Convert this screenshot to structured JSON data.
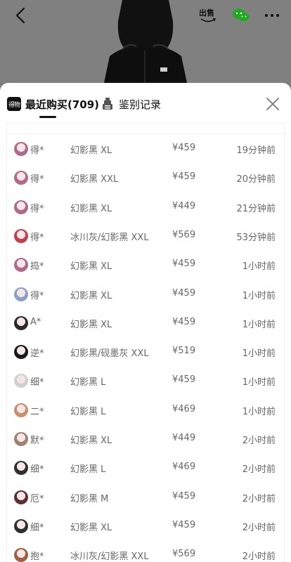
{
  "tabs": {
    "recent_label": "最近购买(709)",
    "auth_label": "鉴别记录",
    "logo_text": "得物"
  },
  "header": {
    "sell_label": "出售"
  },
  "purchases": [
    {
      "name": "得*",
      "spec": "幻影黑 XL",
      "price": "¥459",
      "time": "19分钟前",
      "avatar": "#b06a8a"
    },
    {
      "name": "得*",
      "spec": "幻影黑 XXL",
      "price": "¥459",
      "time": "20分钟前",
      "avatar": "#b06a8a"
    },
    {
      "name": "得*",
      "spec": "幻影黑 XL",
      "price": "¥449",
      "time": "21分钟前",
      "avatar": "#b06a8a"
    },
    {
      "name": "得*",
      "spec": "冰川灰/幻影黑 XXL",
      "price": "¥569",
      "time": "53分钟前",
      "avatar": "#c04050"
    },
    {
      "name": "捣*",
      "spec": "幻影黑 XL",
      "price": "¥459",
      "time": "1小时前",
      "avatar": "#b06a8a"
    },
    {
      "name": "得*",
      "spec": "幻影黑 XL",
      "price": "¥459",
      "time": "1小时前",
      "avatar": "#8ba0c8"
    },
    {
      "name": "A*",
      "spec": "幻影黑 XL",
      "price": "¥459",
      "time": "1小时前",
      "avatar": "#2a2a2a"
    },
    {
      "name": "逆*",
      "spec": "幻影黑/砚墨灰 XXL",
      "price": "¥519",
      "time": "1小时前",
      "avatar": "#1a1a1a"
    },
    {
      "name": "细*",
      "spec": "幻影黑 L",
      "price": "¥459",
      "time": "1小时前",
      "avatar": "#d0d0d0"
    },
    {
      "name": "二*",
      "spec": "幻影黑 L",
      "price": "¥469",
      "time": "1小时前",
      "avatar": "#c89070"
    },
    {
      "name": "默*",
      "spec": "幻影黑 XL",
      "price": "¥449",
      "time": "2小时前",
      "avatar": "#a08070"
    },
    {
      "name": "细*",
      "spec": "幻影黑 L",
      "price": "¥469",
      "time": "2小时前",
      "avatar": "#303030"
    },
    {
      "name": "厄*",
      "spec": "幻影黑 M",
      "price": "¥459",
      "time": "2小时前",
      "avatar": "#603030"
    },
    {
      "name": "细*",
      "spec": "幻影黑 XL",
      "price": "¥459",
      "time": "2小时前",
      "avatar": "#303030"
    },
    {
      "name": "抱*",
      "spec": "冰川灰/幻影黑 XXL",
      "price": "¥569",
      "time": "2小时前",
      "avatar": "#a06040"
    }
  ]
}
